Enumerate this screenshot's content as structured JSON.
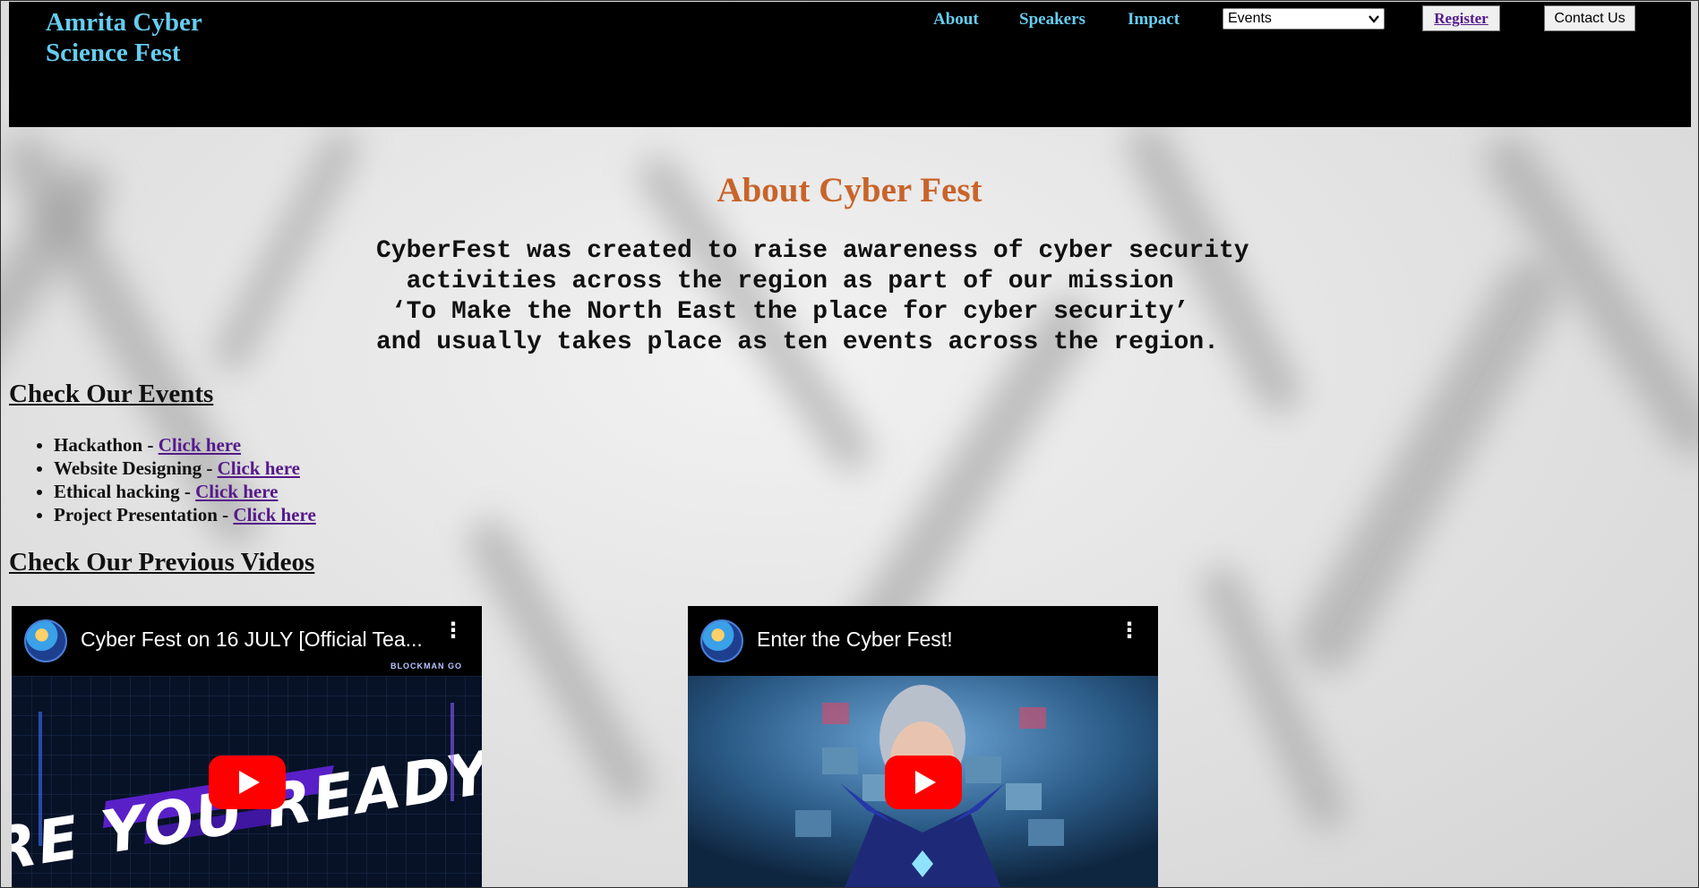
{
  "header": {
    "brand": "Amrita Cyber Science Fest",
    "nav": {
      "about": "About",
      "speakers": "Speakers",
      "impact": "Impact"
    },
    "events_select": {
      "selected": "Events",
      "icon": "chevron-down-icon"
    },
    "register_label": "Register",
    "contact_label": "Contact Us"
  },
  "about": {
    "title": "About Cyber Fest",
    "lines": [
      "CyberFest was created to raise awareness of cyber security",
      "  activities across the region as part of our mission",
      " ‘To Make the North East the place for cyber security’",
      "and usually takes place as ten events across the region."
    ]
  },
  "events_section": {
    "heading": "Check Our Events",
    "separator": " - ",
    "items": [
      {
        "name": "Hackathon",
        "link": "Click here"
      },
      {
        "name": "Website Designing",
        "link": "Click here"
      },
      {
        "name": "Ethical hacking",
        "link": "Click here"
      },
      {
        "name": "Project Presentation",
        "link": "Click here"
      }
    ]
  },
  "videos_section": {
    "heading": "Check Our Previous Videos",
    "videos": [
      {
        "title": "Cyber Fest on 16 JULY [Official Tea...",
        "thumbnail_text": "ARE YOU READY?",
        "brand_mark": "BLOCKMAN GO",
        "icons": [
          "channel-avatar-icon",
          "more-options-icon",
          "youtube-play-icon"
        ]
      },
      {
        "title": "Enter the Cyber Fest!",
        "icons": [
          "channel-avatar-icon",
          "more-options-icon",
          "youtube-play-icon"
        ]
      }
    ]
  },
  "colors": {
    "header_bg": "#000000",
    "nav_text": "#66ccee",
    "about_title": "#c8642a",
    "link": "#551a8b",
    "youtube_red": "#ff0000"
  }
}
